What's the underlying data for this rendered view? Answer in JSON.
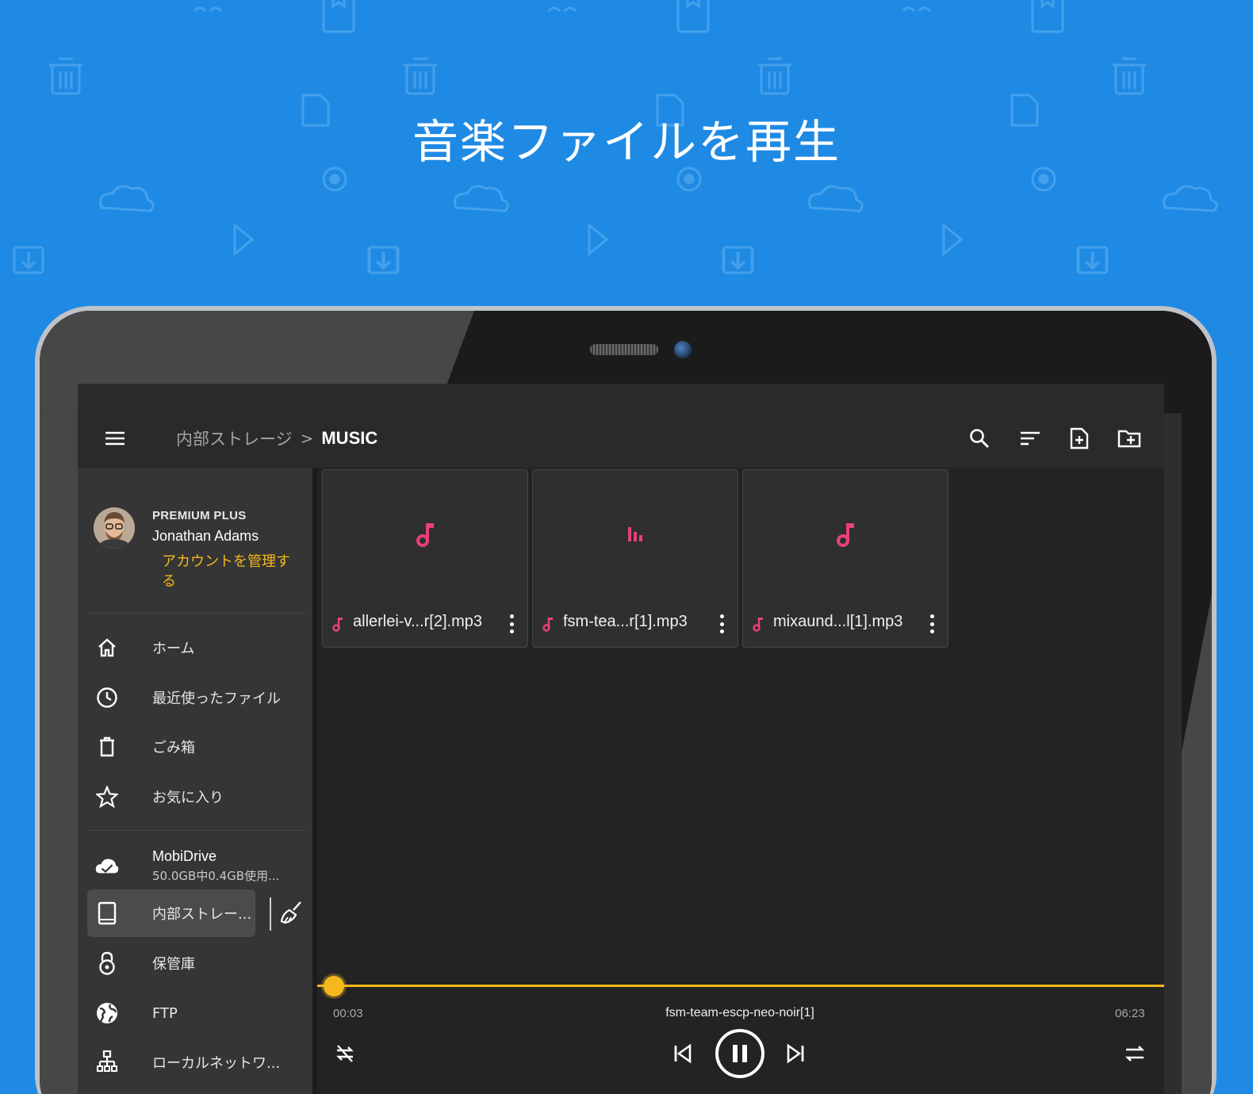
{
  "headline": "音楽ファイルを再生",
  "toolbar": {
    "menu_icon": "menu-icon",
    "breadcrumb_root": "内部ストレージ",
    "breadcrumb_separator": ">",
    "breadcrumb_current": "MUSIC",
    "actions": [
      "search-icon",
      "sort-icon",
      "new-file-icon",
      "new-folder-icon"
    ]
  },
  "account": {
    "plan": "PREMIUM PLUS",
    "name": "Jonathan Adams",
    "manage_link": "アカウントを管理する"
  },
  "sidebar": {
    "items": [
      {
        "label": "ホーム",
        "icon": "home-icon"
      },
      {
        "label": "最近使ったファイル",
        "icon": "clock-icon"
      },
      {
        "label": "ごみ箱",
        "icon": "trash-icon"
      },
      {
        "label": "お気に入り",
        "icon": "star-icon"
      }
    ],
    "cloud": {
      "label": "MobiDrive",
      "usage": "50.0GB中0.4GB使用...",
      "icon": "cloud-icon"
    },
    "storage": [
      {
        "label": "内部ストレー...",
        "icon": "tablet-icon",
        "active": true
      },
      {
        "label": "保管庫",
        "icon": "vault-lock-icon"
      },
      {
        "label": "FTP",
        "icon": "globe-icon"
      },
      {
        "label": "ローカルネットワ...",
        "icon": "network-icon"
      }
    ],
    "clean_icon": "broom-icon"
  },
  "files": [
    {
      "name": "allerlei-v...r[2].mp3",
      "icon": "music-note-icon"
    },
    {
      "name": "fsm-tea...r[1].mp3",
      "icon": "equalizer-icon"
    },
    {
      "name": "mixaund...l[1].mp3",
      "icon": "music-note-icon"
    }
  ],
  "player": {
    "elapsed": "00:03",
    "duration": "06:23",
    "title": "fsm-team-escp-neo-noir[1]",
    "progress_fraction": 0.008,
    "controls": [
      "repeat-off-icon",
      "previous-icon",
      "pause-icon",
      "next-icon",
      "shuffle-icon"
    ]
  },
  "colors": {
    "background": "#1f8ae4",
    "accent_music": "#e8417a",
    "accent_progress": "#f4b81c",
    "screen": "#232323"
  }
}
